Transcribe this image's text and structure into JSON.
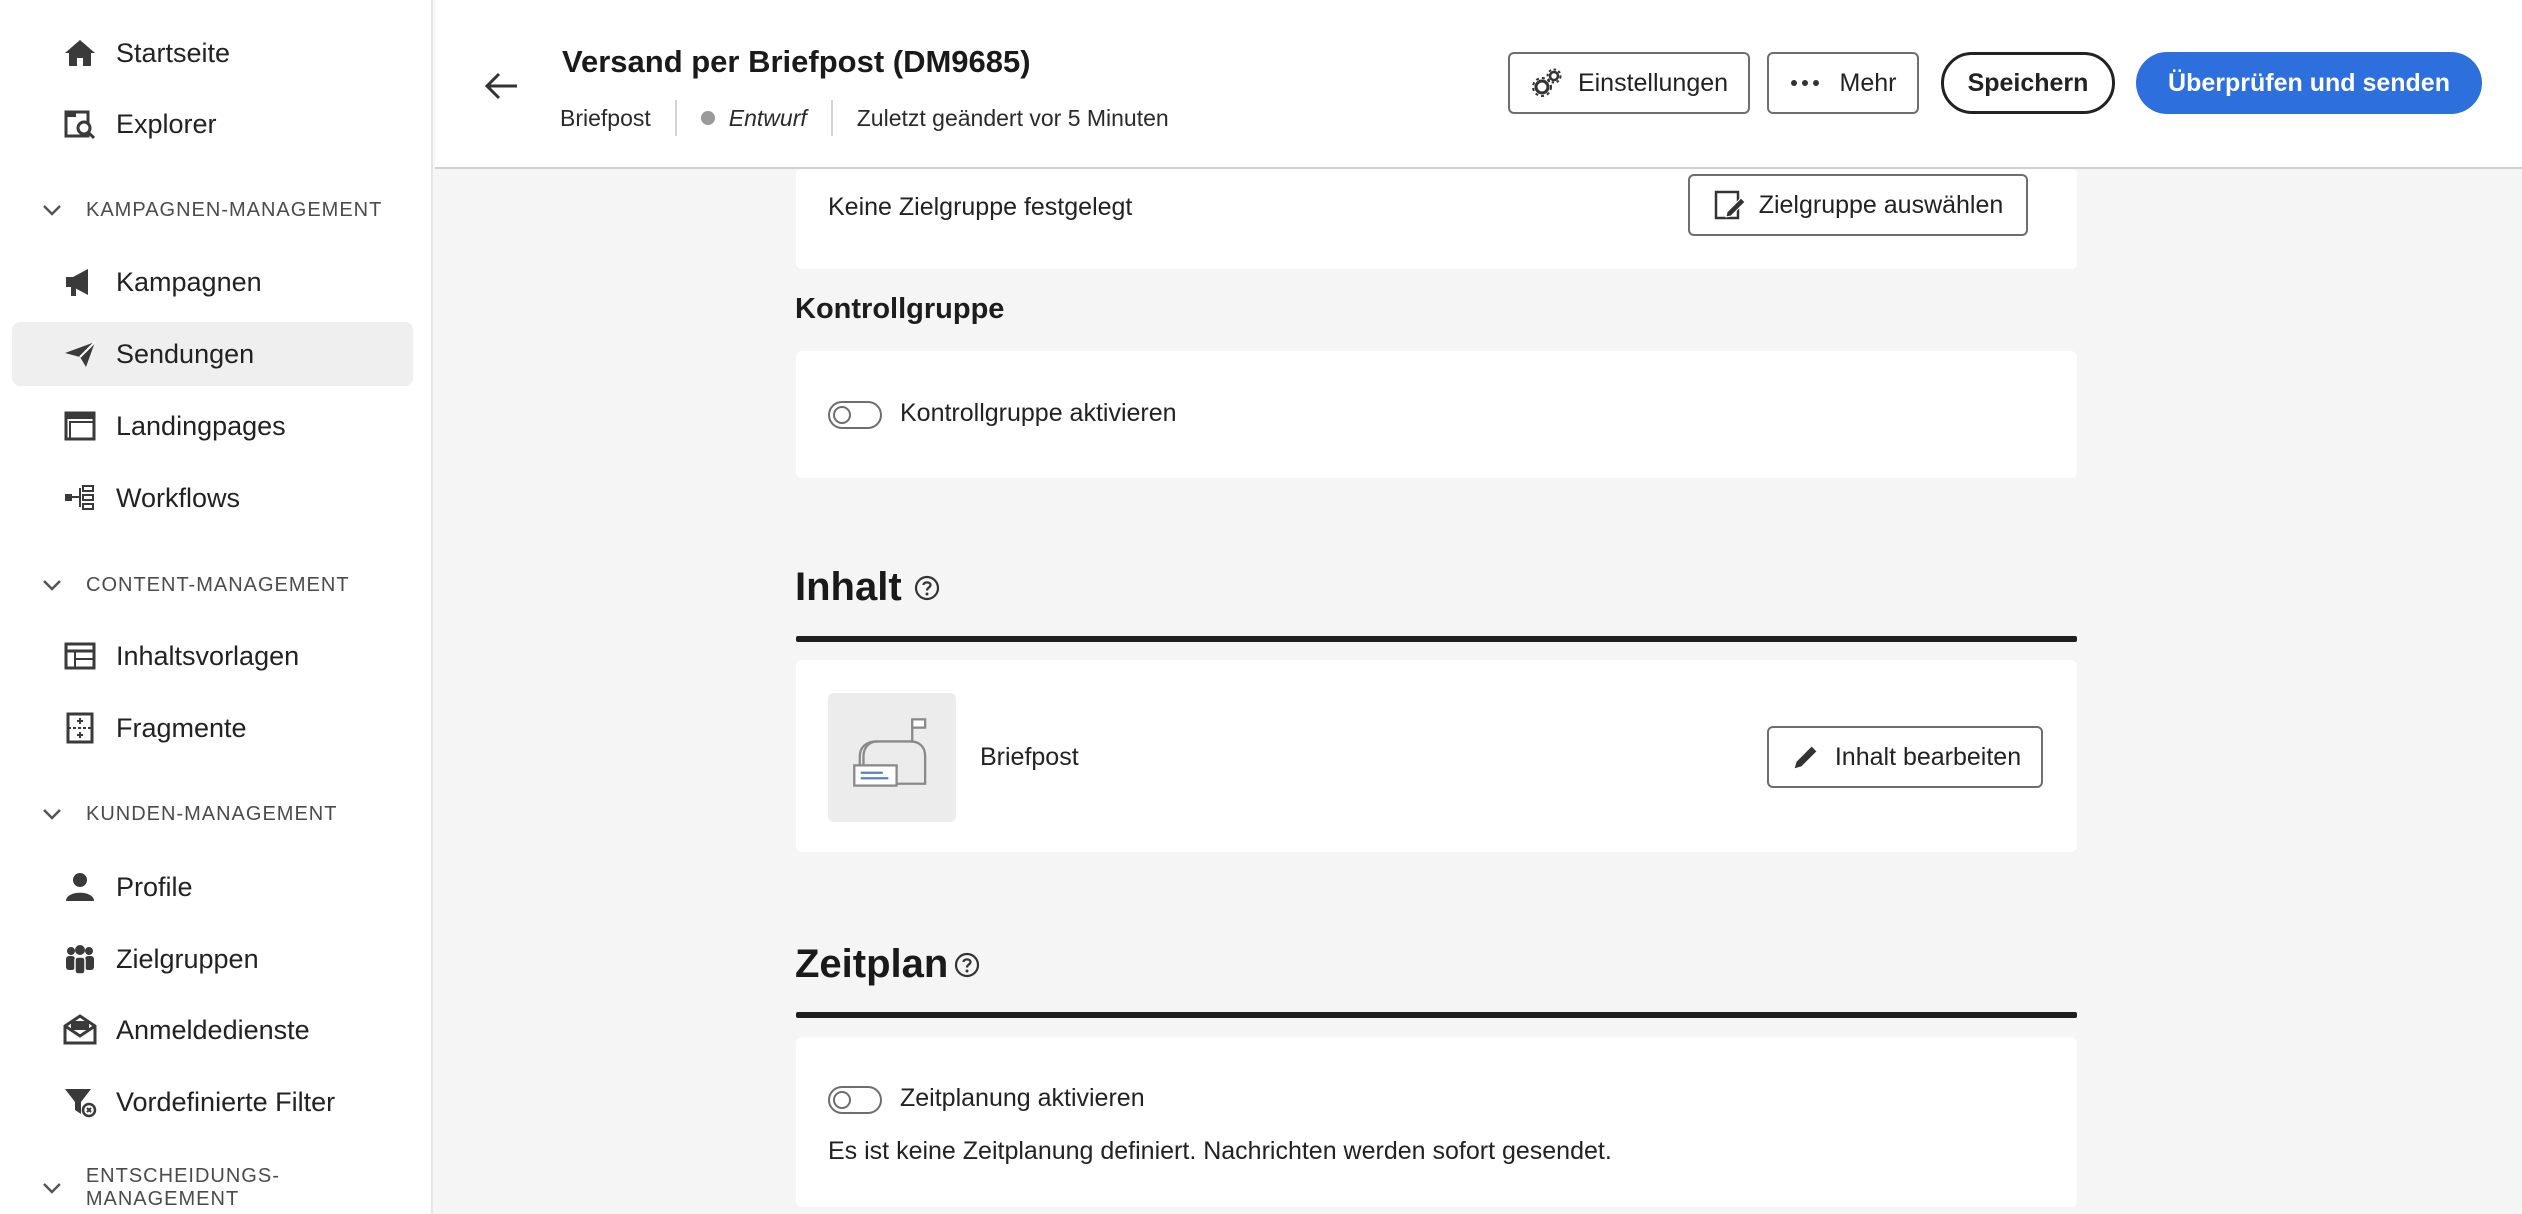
{
  "sidebar": {
    "items": [
      {
        "label": "Startseite",
        "icon": "home-icon"
      },
      {
        "label": "Explorer",
        "icon": "explorer-icon"
      },
      {
        "label": "Kampagnen",
        "icon": "megaphone-icon"
      },
      {
        "label": "Sendungen",
        "icon": "send-icon",
        "active": true
      },
      {
        "label": "Landingpages",
        "icon": "landing-page-icon"
      },
      {
        "label": "Workflows",
        "icon": "workflow-icon"
      },
      {
        "label": "Inhaltsvorlagen",
        "icon": "template-icon"
      },
      {
        "label": "Fragmente",
        "icon": "fragment-icon"
      },
      {
        "label": "Profile",
        "icon": "user-icon"
      },
      {
        "label": "Zielgruppen",
        "icon": "audience-icon"
      },
      {
        "label": "Anmeldedienste",
        "icon": "subscription-icon"
      },
      {
        "label": "Vordefinierte Filter",
        "icon": "filter-icon"
      }
    ],
    "sections": [
      "KAMPAGNEN-MANAGEMENT",
      "CONTENT-MANAGEMENT",
      "KUNDEN-MANAGEMENT",
      "ENTSCHEIDUNGS-MANAGEMENT"
    ]
  },
  "header": {
    "title": "Versand per Briefpost (DM9685)",
    "channel": "Briefpost",
    "status": "Entwurf",
    "modified": "Zuletzt geändert vor 5 Minuten",
    "settings_label": "Einstellungen",
    "more_label": "Mehr",
    "save_label": "Speichern",
    "review_label": "Überprüfen und senden"
  },
  "audience": {
    "empty_text": "Keine Zielgruppe festgelegt",
    "select_label": "Zielgruppe auswählen"
  },
  "control_group": {
    "heading": "Kontrollgruppe",
    "toggle_label": "Kontrollgruppe aktivieren",
    "enabled": false
  },
  "content": {
    "heading": "Inhalt",
    "channel_label": "Briefpost",
    "edit_label": "Inhalt bearbeiten"
  },
  "schedule": {
    "heading": "Zeitplan",
    "toggle_label": "Zeitplanung aktivieren",
    "enabled": false,
    "note": "Es ist keine Zeitplanung definiert. Nachrichten werden sofort gesendet."
  },
  "colors": {
    "primary": "#2d6fdc",
    "active_nav": "#efefef"
  }
}
